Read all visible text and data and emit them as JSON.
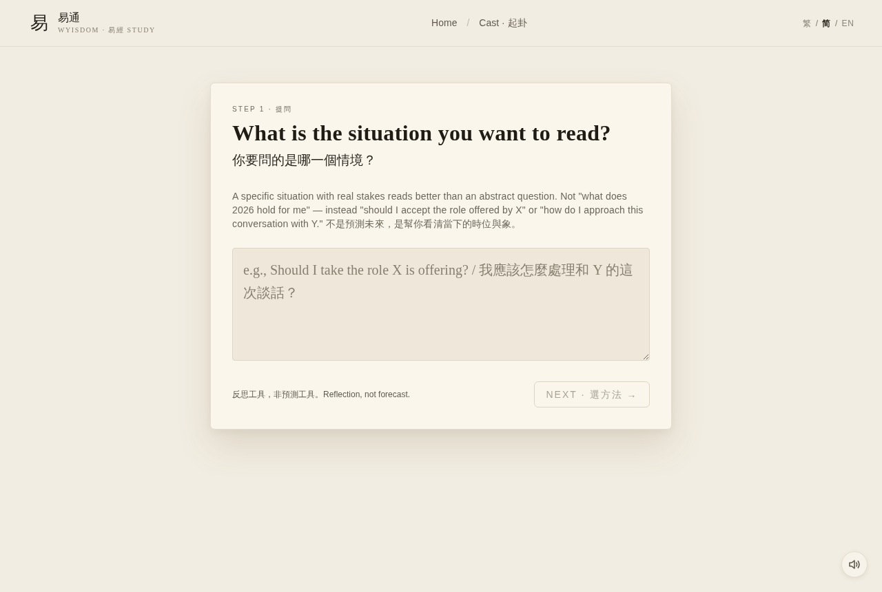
{
  "header": {
    "logo_glyph": "易",
    "brand": "易通",
    "tagline": "WYISDOM · 易經 STUDY",
    "breadcrumb": [
      {
        "label": "Home"
      },
      {
        "label": "Cast · 起卦",
        "separator": "/"
      }
    ],
    "languages": [
      {
        "label": "繁",
        "selected": false
      },
      {
        "label": "简",
        "selected": true,
        "separator": "/"
      },
      {
        "label": "EN",
        "selected": false,
        "separator": "/"
      }
    ]
  },
  "card": {
    "step_label": "STEP 1 · 提問",
    "title": "What is the situation you want to read?",
    "subtitle": "你要問的是哪一個情境？",
    "description": "A specific situation with real stakes reads better than an abstract question. Not \"what does 2026 hold for me\" — instead \"should I accept the role offered by X\" or \"how do I approach this conversation with Y.\" 不是預測未來，是幫你看清當下的時位與象。",
    "question_field": {
      "placeholder": "e.g., Should I take the role X is offering? / 我應該怎麼處理和 Y 的這次談話？"
    },
    "footer_note": "反思工具，非預測工具。Reflection, not forecast.",
    "next_button": {
      "label": "NEXT · 選方法 →",
      "disabled": true
    }
  }
}
